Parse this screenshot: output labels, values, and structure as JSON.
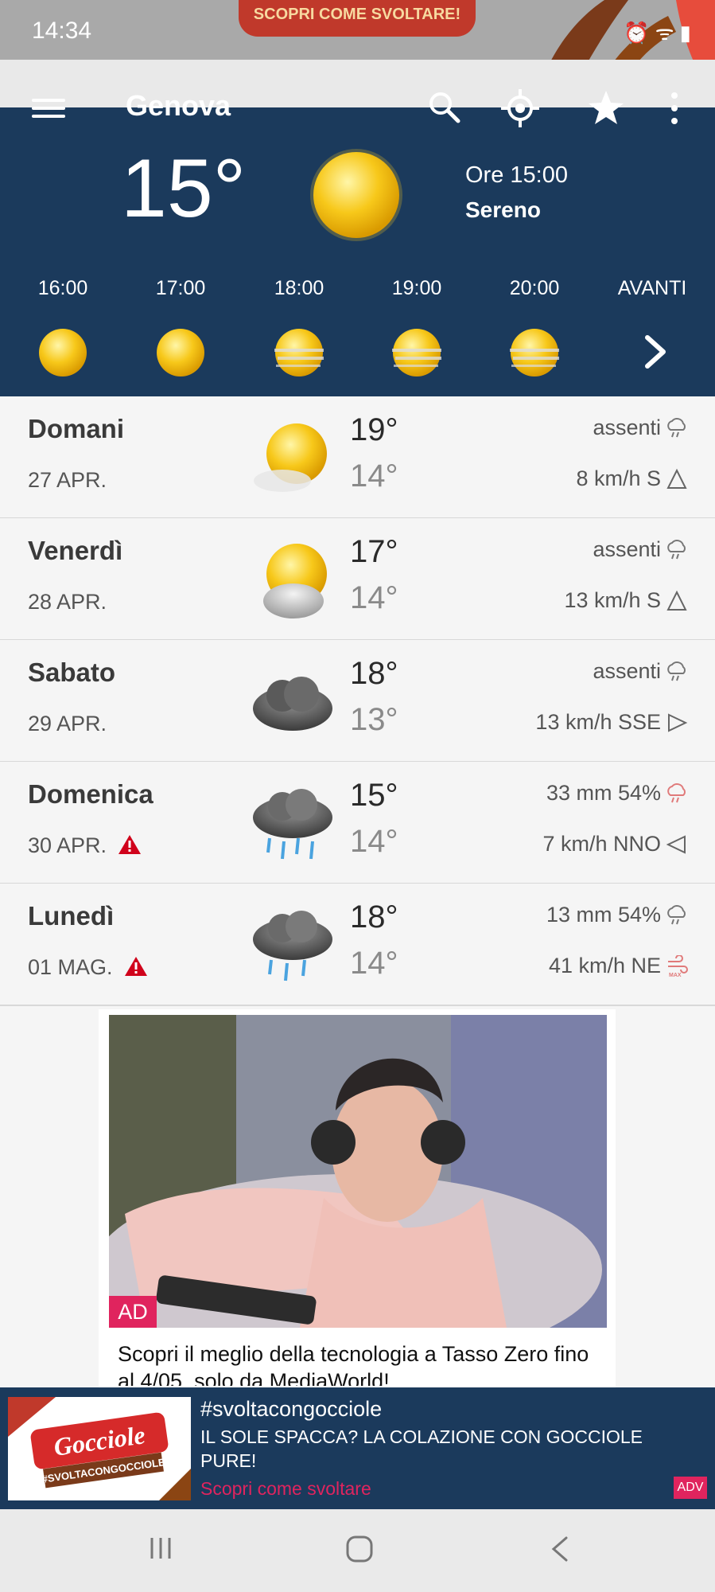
{
  "status": {
    "time": "14:34",
    "icons": "⏰ ᯤ ▮"
  },
  "top_banner": {
    "text": "SCOPRI COME SVOLTARE!"
  },
  "header": {
    "city": "Genova",
    "temp_now": "15°",
    "time_now": "Ore 15:00",
    "desc_now": "Sereno",
    "hours": [
      {
        "label": "16:00",
        "icon": "sun-icon"
      },
      {
        "label": "17:00",
        "icon": "sun-icon"
      },
      {
        "label": "18:00",
        "icon": "hazy-sun-icon"
      },
      {
        "label": "19:00",
        "icon": "hazy-sun-icon"
      },
      {
        "label": "20:00",
        "icon": "hazy-sun-icon"
      }
    ],
    "next_label": "AVANTI"
  },
  "days": [
    {
      "name": "Domani",
      "date": "27 APR.",
      "alert": false,
      "max": "19°",
      "min": "14°",
      "precip": "assenti",
      "wind": "8 km/h S",
      "icon": "sun-haze-icon"
    },
    {
      "name": "Venerdì",
      "date": "28 APR.",
      "alert": false,
      "max": "17°",
      "min": "14°",
      "precip": "assenti",
      "wind": "13 km/h S",
      "icon": "partly-cloudy-icon"
    },
    {
      "name": "Sabato",
      "date": "29 APR.",
      "alert": false,
      "max": "18°",
      "min": "13°",
      "precip": "assenti",
      "wind": "13 km/h SSE",
      "icon": "cloudy-icon"
    },
    {
      "name": "Domenica",
      "date": "30 APR.",
      "alert": true,
      "max": "15°",
      "min": "14°",
      "precip": "33 mm 54%",
      "wind": "7 km/h NNO",
      "icon": "rain-icon"
    },
    {
      "name": "Lunedì",
      "date": "01 MAG.",
      "alert": true,
      "max": "18°",
      "min": "14°",
      "precip": "13 mm 54%",
      "wind": "41 km/h NE",
      "icon": "rain-icon"
    }
  ],
  "ad": {
    "badge": "AD",
    "text": "Scopri il meglio della tecnologia a Tasso Zero fino al 4/05, solo da MediaWorld!"
  },
  "bottom_banner": {
    "logo_text": "Gocciole",
    "logo_tag": "#SVOLTACONGOCCIOLE",
    "hashtag": "#svoltacongocciole",
    "text": "IL SOLE SPACCA? LA COLAZIONE CON GOCCIOLE PURE!",
    "link": "Scopri come svoltare",
    "adv": "ADV"
  },
  "colors": {
    "header_bg": "#1b3a5c",
    "accent": "#e0245e",
    "alert": "#d0021b"
  }
}
